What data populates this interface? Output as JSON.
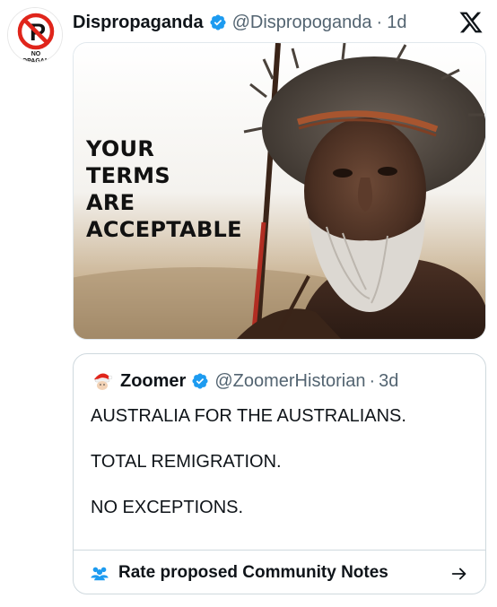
{
  "tweet": {
    "display_name": "Dispropaganda",
    "handle": "@Dispropoganda",
    "separator": "·",
    "time": "1d",
    "avatar": {
      "icon": "no-propaganda-sign-icon",
      "text": "NO PROPAGANDA",
      "colors": {
        "ring": "#e0251b",
        "letter": "#111111"
      }
    },
    "media": {
      "caption_lines": [
        "YOUR",
        "TERMS",
        "ARE",
        "ACCEPTABLE"
      ]
    }
  },
  "quote": {
    "display_name": "Zoomer",
    "handle": "@ZoomerHistorian",
    "separator": "·",
    "time": "3d",
    "lines": [
      "AUSTRALIA FOR THE AUSTRALIANS.",
      "TOTAL REMIGRATION.",
      "NO EXCEPTIONS."
    ]
  },
  "community_notes": {
    "label": "Rate proposed Community Notes",
    "icon": "people-icon",
    "arrow_icon": "arrow-right-icon"
  },
  "colors": {
    "verified": "#1d9bf0",
    "secondary_text": "#536471",
    "border": "#cfd9de"
  }
}
